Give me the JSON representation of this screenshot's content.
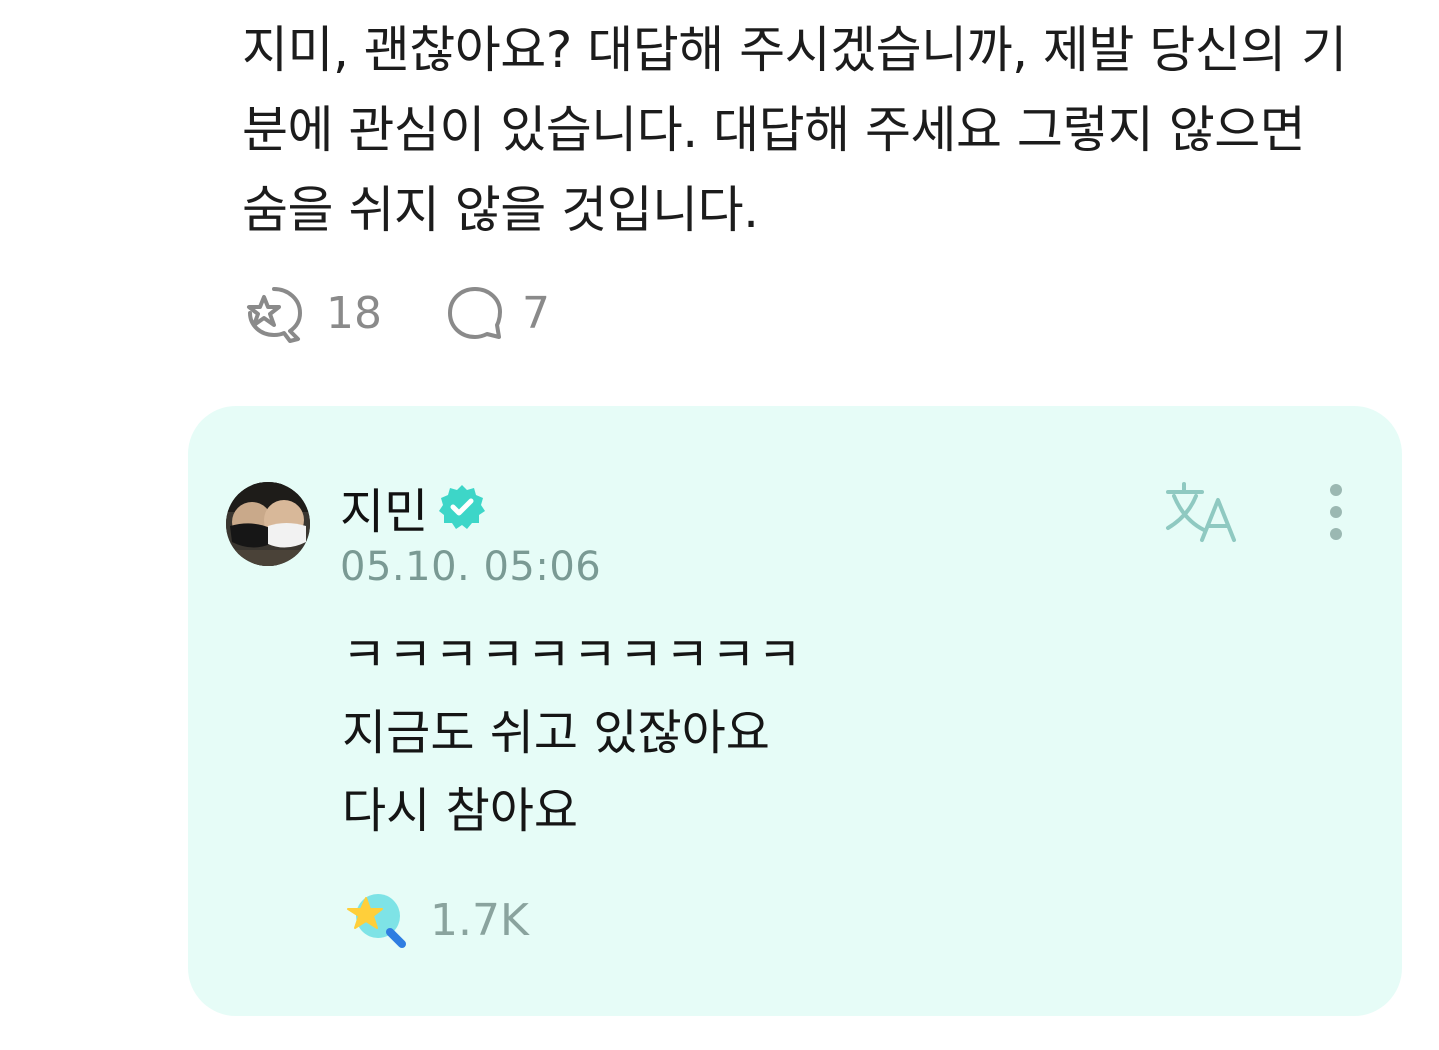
{
  "post": {
    "text": "지미, 괜찮아요? 대답해 주시겠습니까, 제발 당신의 기분에 관심이 있습니다. 대답해 주세요 그렇지 않으면 숨을 쉬지 않을 것입니다.",
    "likes": "18",
    "comments": "7"
  },
  "reply": {
    "author": "지민",
    "timestamp": "05.10. 05:06",
    "lines": [
      "ㅋㅋㅋㅋㅋㅋㅋㅋㅋㅋ",
      "지금도 쉬고 있잖아요",
      "다시 참아요"
    ],
    "likes": "1.7K",
    "icons": {
      "verified": "verified-badge-icon",
      "translate": "translate-icon",
      "more": "more-vertical-icon",
      "like": "star-like-icon"
    }
  },
  "colors": {
    "card_background": "#e6fcf7",
    "verified": "#3dd6c8",
    "muted_text": "#7a9a94",
    "like_star": "#ffcf3a",
    "like_bubble": "#7ee3e6",
    "like_handle": "#2f7de1"
  }
}
